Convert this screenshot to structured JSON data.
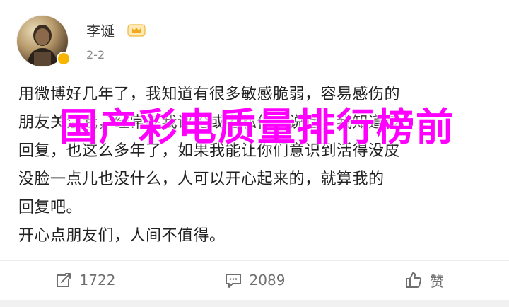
{
  "user": {
    "name": "李诞",
    "time": "2-2"
  },
  "content": {
    "lines": [
      "用微博好几年了，我知道有很多敏感脆弱，容易感伤的",
      "朋友关注我，经常在我评论或者私信里说话，我知道该",
      "回复，也这么多年了，如果我能让你们意识到活得没皮",
      "没脸一点儿也没什么，人可以开心起来的，就算我的",
      "回复吧。",
      "开心点朋友们，人间不值得。"
    ]
  },
  "overlay": {
    "title": "国产彩电质量排行榜前"
  },
  "actions": {
    "repost_count": "1722",
    "comment_count": "2089",
    "like_label": "赞"
  },
  "colors": {
    "overlay": "#ff00ff",
    "vip": "#f7b500",
    "muted": "#8a8a8a"
  }
}
